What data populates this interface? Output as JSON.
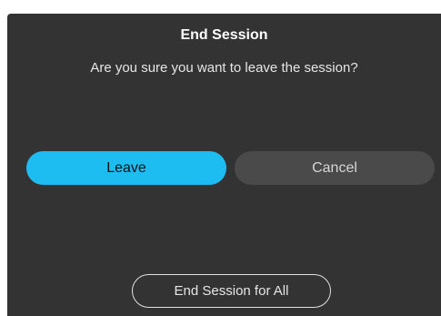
{
  "dialog": {
    "title": "End Session",
    "message": "Are you sure you want to leave the session?",
    "leave_label": "Leave",
    "cancel_label": "Cancel",
    "end_all_label": "End Session for All"
  },
  "colors": {
    "dialog_background": "#333333",
    "primary_accent": "#1dbdf2",
    "secondary_button": "#4a4a4a"
  }
}
